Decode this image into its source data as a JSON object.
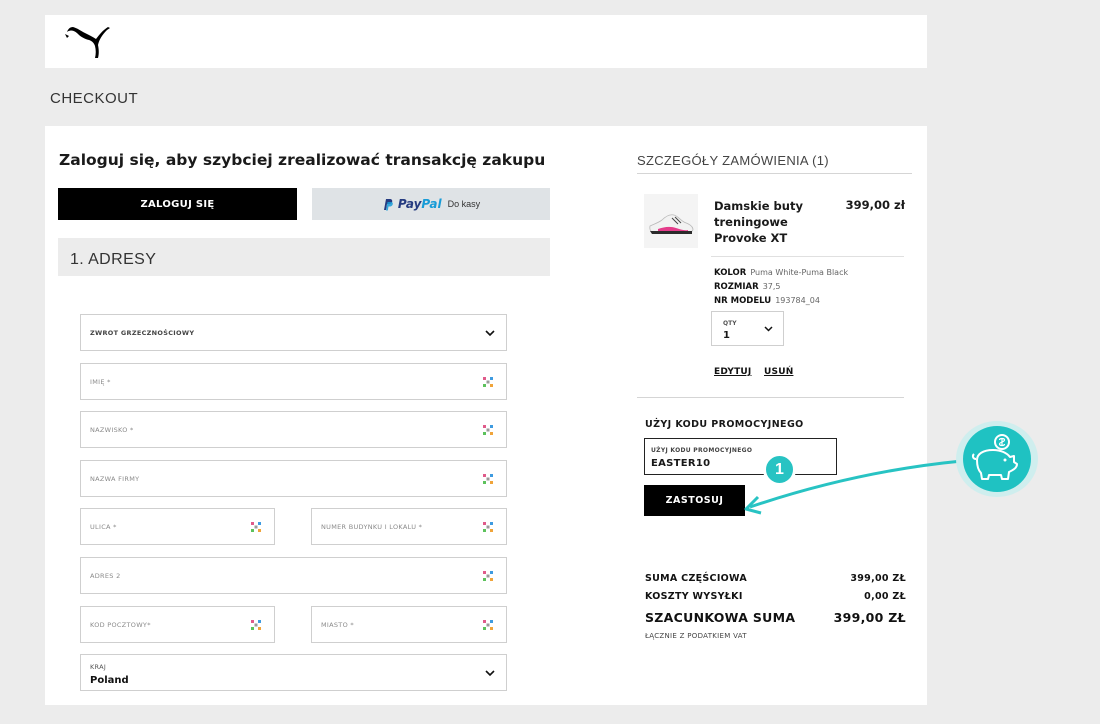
{
  "page": {
    "heading": "CHECKOUT"
  },
  "login": {
    "title": "Zaloguj się, aby szybciej zrealizować transakcję zakupu",
    "login_button": "ZALOGUJ SIĘ",
    "paypal_word_1": "Pay",
    "paypal_word_2": "Pal",
    "paypal_suffix": "Do kasy"
  },
  "address_section": {
    "title": "1. ADRESY",
    "salutation_label": "ZWROT GRZECZNOŚCIOWY",
    "first_name_label": "IMIĘ *",
    "last_name_label": "NAZWISKO *",
    "company_label": "NAZWA FIRMY",
    "street_label": "ULICA *",
    "building_label": "NUMER BUDYNKU I LOKALU *",
    "address2_label": "ADRES 2",
    "postcode_label": "KOD POCZTOWY*",
    "city_label": "MIASTO *",
    "country_label": "KRAJ",
    "country_value": "Poland"
  },
  "order_summary": {
    "title": "SZCZEGÓŁY ZAMÓWIENIA (1)",
    "product": {
      "name": "Damskie buty treningowe Provoke XT",
      "price": "399,00 zł",
      "color_label": "KOLOR",
      "color_value": "Puma White-Puma Black",
      "size_label": "ROZMIAR",
      "size_value": "37,5",
      "model_label": "NR MODELU",
      "model_value": "193784_04",
      "qty_label": "QTY",
      "qty_value": "1",
      "edit_label": "EDYTUJ",
      "remove_label": "USUŃ"
    },
    "promo": {
      "title": "UŻYJ KODU PROMOCYJNEGO",
      "field_label": "UŻYJ KODU PROMOCYJNEGO",
      "field_value": "EASTER10",
      "apply_label": "ZASTOSUJ"
    },
    "totals": {
      "subtotal_label": "SUMA CZĘŚCIOWA",
      "subtotal_value": "399,00 ZŁ",
      "shipping_label": "KOSZTY WYSYŁKI",
      "shipping_value": "0,00 ZŁ",
      "estimated_label": "SZACUNKOWA SUMA",
      "estimated_value": "399,00 ZŁ",
      "vat_note": "ŁĄCZNIE Z PODATKIEM VAT"
    }
  },
  "annotation": {
    "step_number": "1",
    "accent_color": "#28c3c3"
  },
  "icons": {
    "autofill": "autofill-icon",
    "chevron": "chevron-down-icon",
    "logo": "puma-logo",
    "piggy": "piggy-bank-icon"
  }
}
